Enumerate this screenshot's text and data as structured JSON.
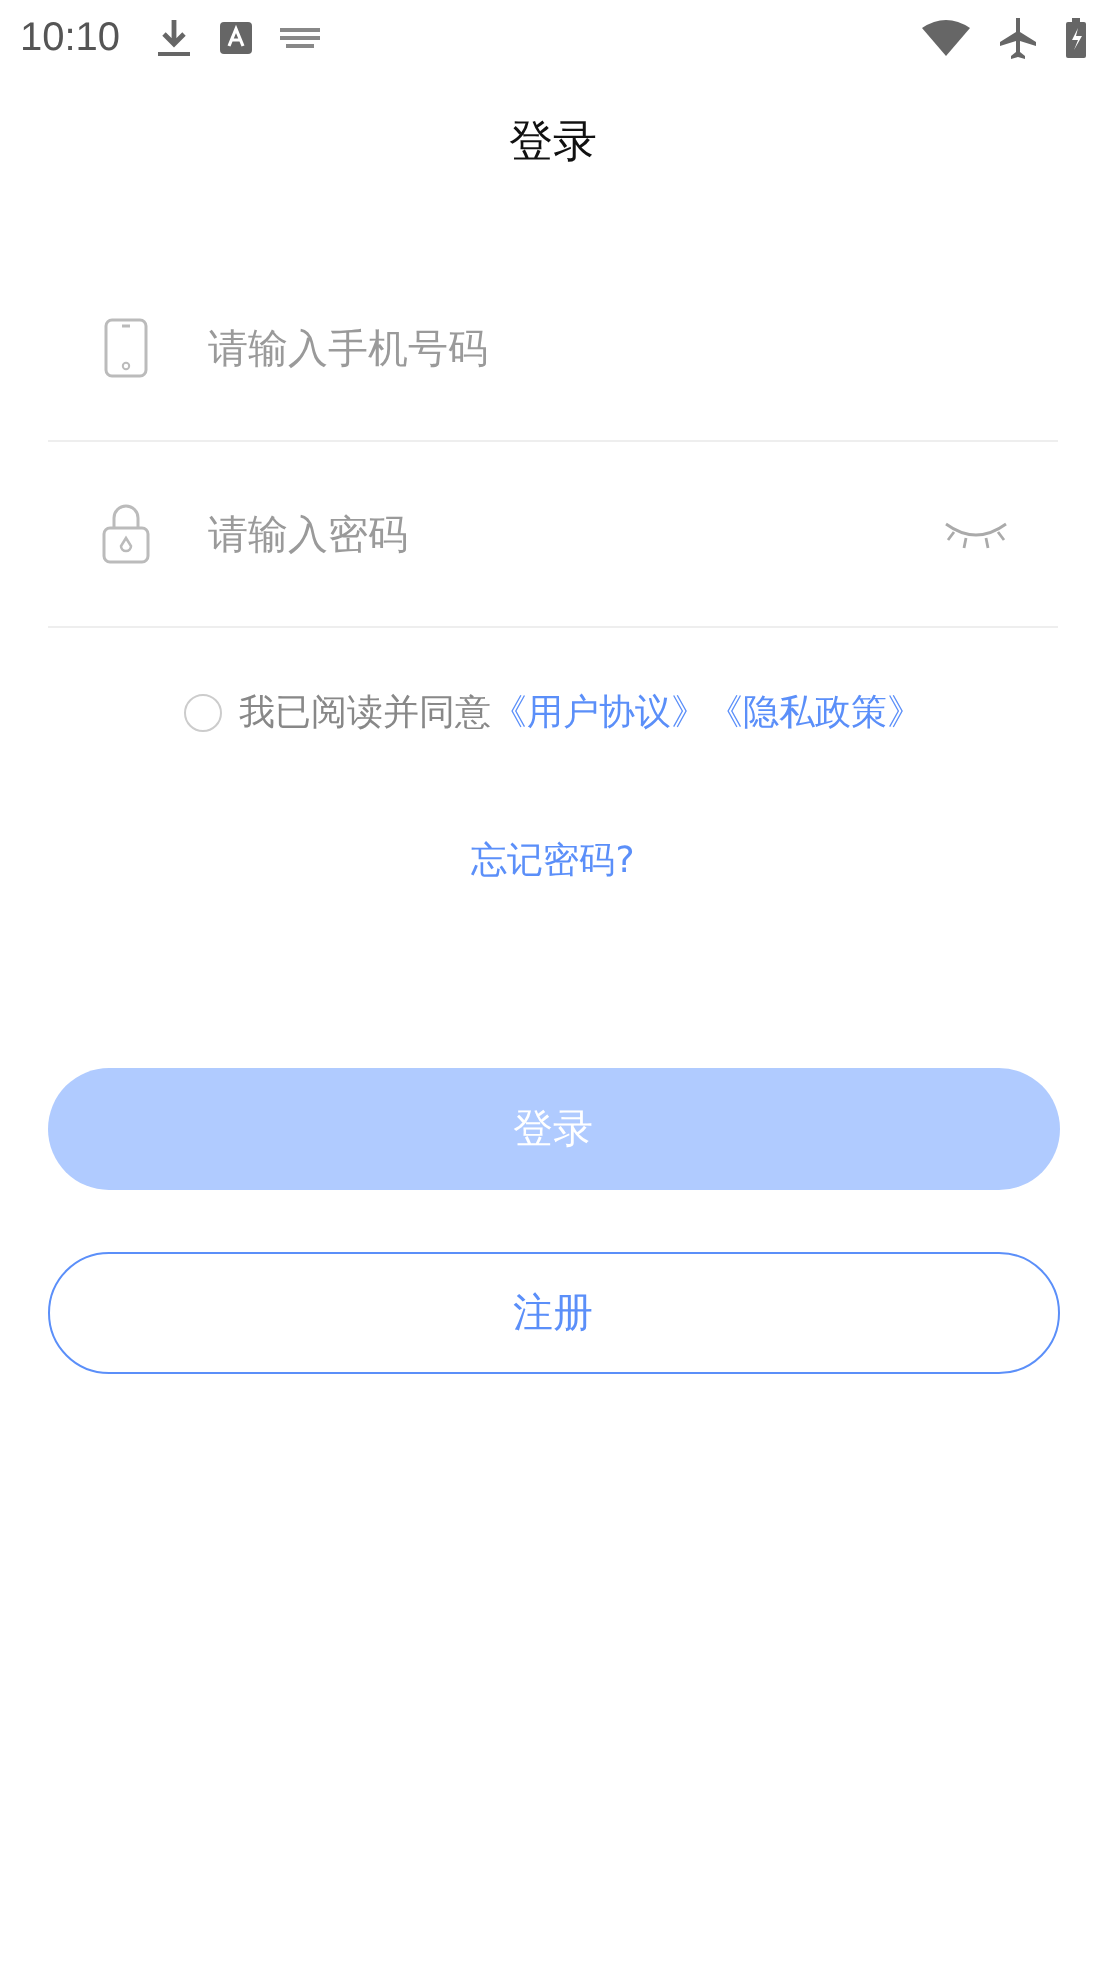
{
  "status_bar": {
    "time": "10:10"
  },
  "title": "登录",
  "phone_field": {
    "placeholder": "请输入手机号码"
  },
  "password_field": {
    "placeholder": "请输入密码",
    "visible": false
  },
  "agreement": {
    "checked": false,
    "text": "我已阅读并同意",
    "links": [
      "《用户协议》",
      "《隐私政策》"
    ]
  },
  "forgot_link": "忘记密码?",
  "login_button": {
    "label": "登录",
    "disabled": true
  },
  "register_button": {
    "label": "注册"
  }
}
